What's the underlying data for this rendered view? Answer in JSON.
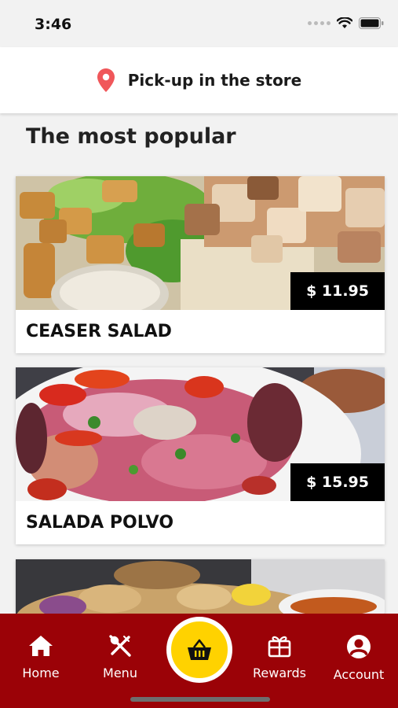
{
  "status_bar": {
    "time": "3:46"
  },
  "pickup": {
    "label": "Pick-up in the store",
    "icon": "location-pin-icon",
    "icon_color": "#f0575a"
  },
  "section": {
    "title": "The most popular"
  },
  "menu_items": [
    {
      "name": "CEASER SALAD",
      "price": "$ 11.95"
    },
    {
      "name": "SALADA POLVO",
      "price": "$ 15.95"
    }
  ],
  "tab_bar": {
    "background": "#9b0207",
    "cart_color": "#ffd200",
    "tabs": [
      {
        "label": "Home",
        "icon": "home-icon"
      },
      {
        "label": "Menu",
        "icon": "utensils-icon"
      },
      {
        "label": "Rewards",
        "icon": "gift-icon"
      },
      {
        "label": "Account",
        "icon": "account-icon"
      }
    ],
    "cart_icon": "basket-icon"
  }
}
